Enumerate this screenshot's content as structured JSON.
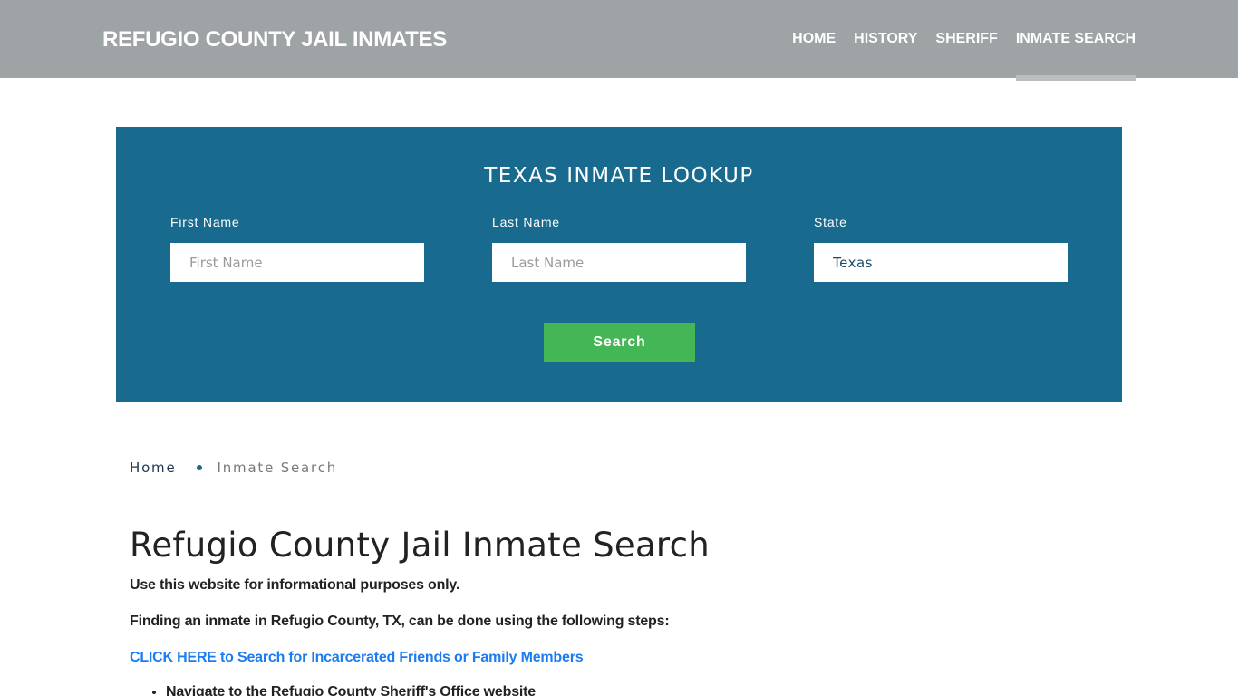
{
  "header": {
    "brand": "REFUGIO COUNTY JAIL INMATES",
    "nav": [
      {
        "label": "HOME",
        "active": false
      },
      {
        "label": "HISTORY",
        "active": false
      },
      {
        "label": "SHERIFF",
        "active": false
      },
      {
        "label": "INMATE SEARCH",
        "active": true
      }
    ]
  },
  "lookup": {
    "title": "TEXAS INMATE LOOKUP",
    "first_name": {
      "label": "First Name",
      "placeholder": "First Name",
      "value": ""
    },
    "last_name": {
      "label": "Last Name",
      "placeholder": "Last Name",
      "value": ""
    },
    "state": {
      "label": "State",
      "value": "Texas"
    },
    "search_label": "Search",
    "colors": {
      "panel": "#186a8e",
      "button": "#45b656"
    }
  },
  "breadcrumb": {
    "home": "Home",
    "current": "Inmate Search"
  },
  "content": {
    "title": "Refugio County Jail Inmate Search",
    "intro": "Use this website for informational purposes only.",
    "steps_intro": "Finding an inmate in Refugio County, TX, can be done using the following steps:",
    "cta_link": "CLICK HERE to Search for Incarcerated Friends or Family Members",
    "steps": [
      "Navigate to the Refugio County Sheriff's Office website"
    ],
    "link_color": "#1b7cf1"
  }
}
